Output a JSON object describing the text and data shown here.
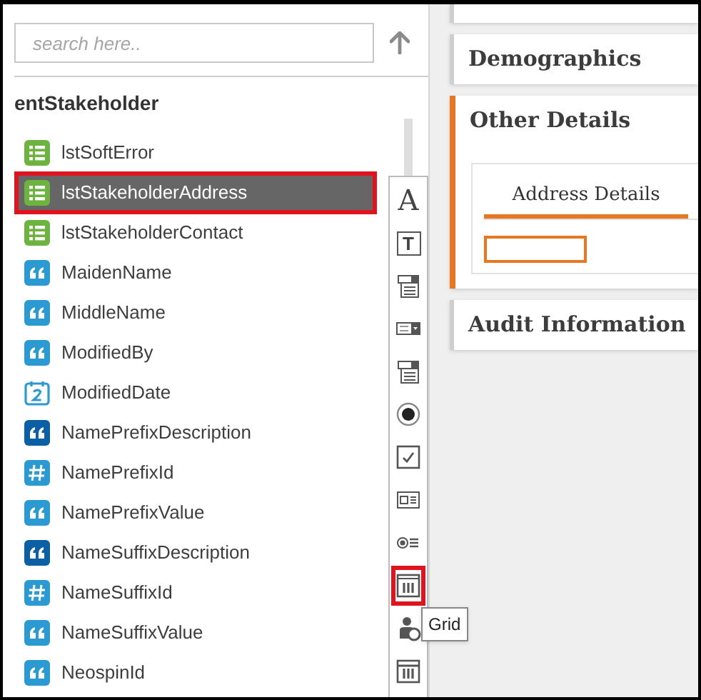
{
  "search": {
    "placeholder": "search here.."
  },
  "entity": {
    "title": "entStakeholder"
  },
  "fields": [
    {
      "kind": "list",
      "label": "lstSoftError",
      "selected": false
    },
    {
      "kind": "list",
      "label": "lstStakeholderAddress",
      "selected": true
    },
    {
      "kind": "list",
      "label": "lstStakeholderContact",
      "selected": false
    },
    {
      "kind": "text",
      "label": "MaidenName",
      "selected": false
    },
    {
      "kind": "text",
      "label": "MiddleName",
      "selected": false
    },
    {
      "kind": "text",
      "label": "ModifiedBy",
      "selected": false
    },
    {
      "kind": "date",
      "label": "ModifiedDate",
      "selected": false
    },
    {
      "kind": "description",
      "label": "NamePrefixDescription",
      "selected": false
    },
    {
      "kind": "number",
      "label": "NamePrefixId",
      "selected": false
    },
    {
      "kind": "text",
      "label": "NamePrefixValue",
      "selected": false
    },
    {
      "kind": "description",
      "label": "NameSuffixDescription",
      "selected": false
    },
    {
      "kind": "number",
      "label": "NameSuffixId",
      "selected": false
    },
    {
      "kind": "text",
      "label": "NameSuffixValue",
      "selected": false
    },
    {
      "kind": "text",
      "label": "NeospinId",
      "selected": false
    }
  ],
  "tools": [
    {
      "kind": "letter",
      "glyph": "A",
      "selected": false
    },
    {
      "kind": "boxed-letter",
      "glyph": "T",
      "selected": false
    },
    {
      "kind": "dropdown-list",
      "selected": false
    },
    {
      "kind": "select",
      "selected": false
    },
    {
      "kind": "dropdown-list",
      "selected": false
    },
    {
      "kind": "radio",
      "selected": false
    },
    {
      "kind": "checkbox",
      "selected": false
    },
    {
      "kind": "card",
      "selected": false
    },
    {
      "kind": "radio-list",
      "selected": false
    },
    {
      "kind": "grid",
      "selected": true,
      "tooltip": "Grid"
    },
    {
      "kind": "person",
      "selected": false
    },
    {
      "kind": "table",
      "selected": false
    }
  ],
  "sections": [
    {
      "title": "Demographics",
      "active": false
    },
    {
      "title": "Other Details",
      "active": true,
      "tabs": [
        {
          "label": "Address Details",
          "selected": true
        }
      ]
    },
    {
      "title": "Audit Information",
      "active": false
    }
  ]
}
